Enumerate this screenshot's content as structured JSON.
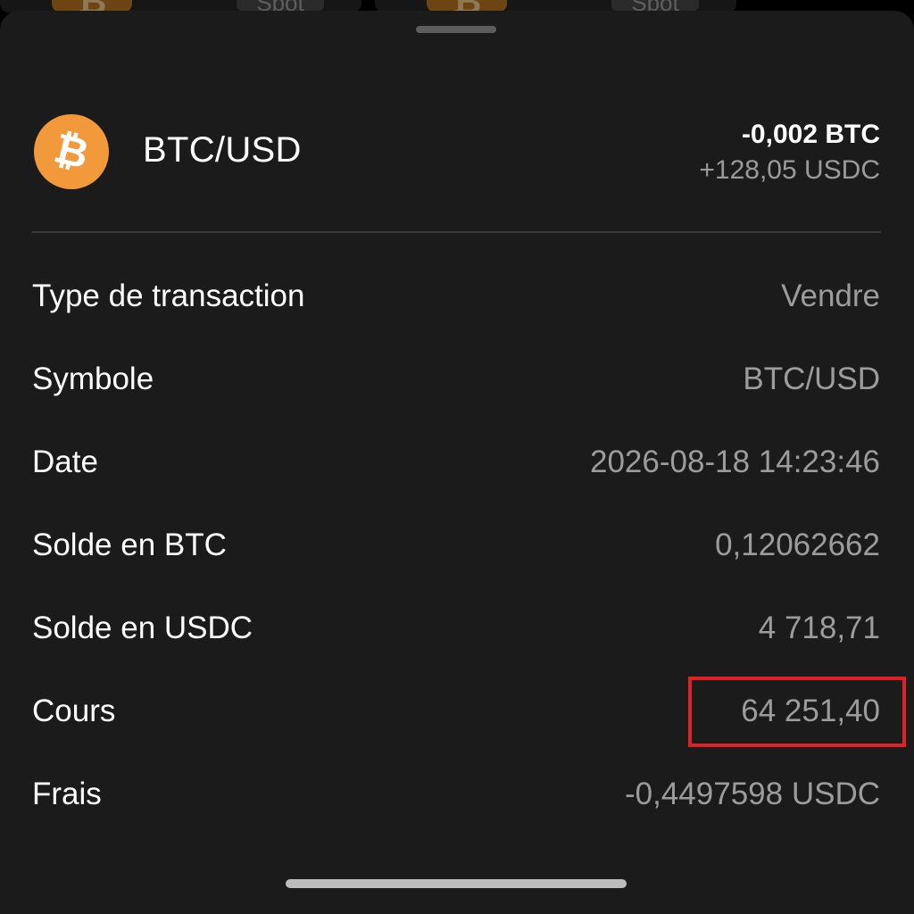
{
  "background": {
    "cards": [
      {
        "tag_label": "Spot"
      },
      {
        "tag_label": "Spot"
      }
    ]
  },
  "header": {
    "icon": "bitcoin-icon",
    "pair": "BTC/USD",
    "amount_primary": "-0,002 BTC",
    "amount_secondary": "+128,05 USDC"
  },
  "details": {
    "rows": [
      {
        "label": "Type de transaction",
        "value": "Vendre"
      },
      {
        "label": "Symbole",
        "value": "BTC/USD"
      },
      {
        "label": "Date",
        "value": "2026-08-18 14:23:46"
      },
      {
        "label": "Solde en BTC",
        "value": "0,12062662"
      },
      {
        "label": "Solde en USDC",
        "value": "4 718,71"
      },
      {
        "label": "Cours",
        "value": "64 251,40",
        "highlighted": true
      },
      {
        "label": "Frais",
        "value": "-0,4497598 USDC"
      }
    ]
  },
  "colors": {
    "sheet_background": "#1b1b1b",
    "bitcoin_orange": "#f29a3b",
    "highlight_border": "#e11f26",
    "label_text": "#ffffff",
    "value_text": "#9c9c9c"
  }
}
